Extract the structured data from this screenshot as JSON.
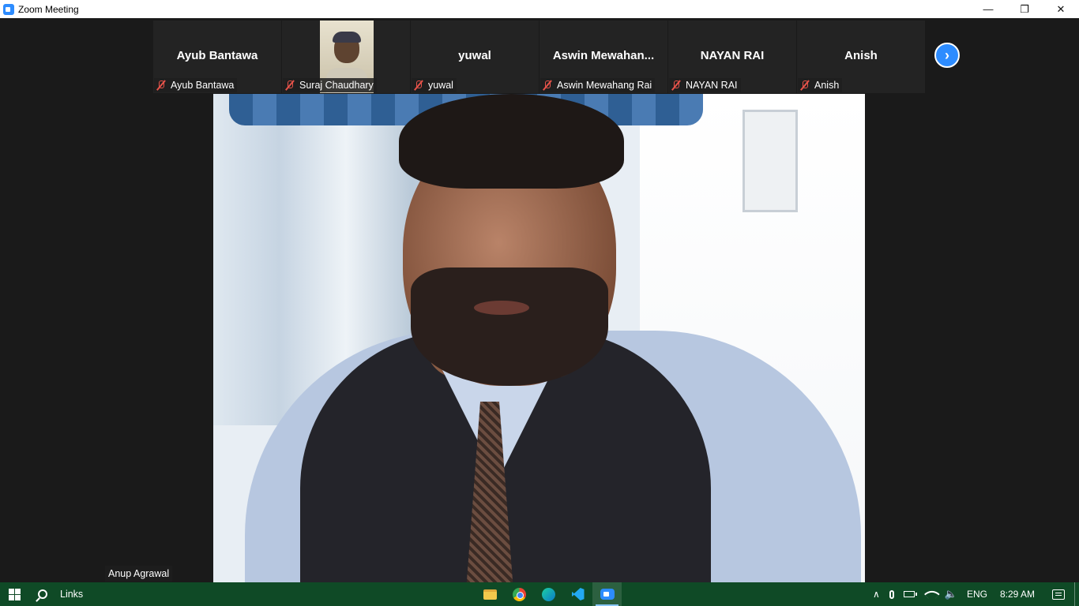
{
  "window": {
    "title": "Zoom Meeting",
    "controls": {
      "minimize": "—",
      "restore": "❐",
      "close": "✕"
    }
  },
  "participants": [
    {
      "big_name": "Ayub Bantawa",
      "label": "Ayub Bantawa",
      "muted": true,
      "has_video": false
    },
    {
      "big_name": "",
      "label": "Suraj Chaudhary",
      "muted": true,
      "has_video": true
    },
    {
      "big_name": "yuwal",
      "label": "yuwal",
      "muted": true,
      "has_video": false
    },
    {
      "big_name": "Aswin  Mewahan...",
      "label": "Aswin Mewahang Rai",
      "muted": true,
      "has_video": false
    },
    {
      "big_name": "NAYAN RAI",
      "label": "NAYAN RAI",
      "muted": true,
      "has_video": false
    },
    {
      "big_name": "Anish",
      "label": "Anish",
      "muted": true,
      "has_video": false
    }
  ],
  "strip_next": "›",
  "active_speaker": {
    "name": "Anup Agrawal"
  },
  "taskbar": {
    "search_label": "Links",
    "apps": [
      "file-explorer-icon",
      "chrome-icon",
      "edge-icon",
      "vscode-icon",
      "zoom-icon"
    ],
    "tray": {
      "chevron": "∧",
      "language": "ENG",
      "time": "8:29 AM",
      "volume": "🔈"
    }
  },
  "colors": {
    "accent": "#2d8cff",
    "muted_mic": "#e8534a",
    "taskbar": "#0f4a26",
    "stage": "#1a1a1a"
  }
}
